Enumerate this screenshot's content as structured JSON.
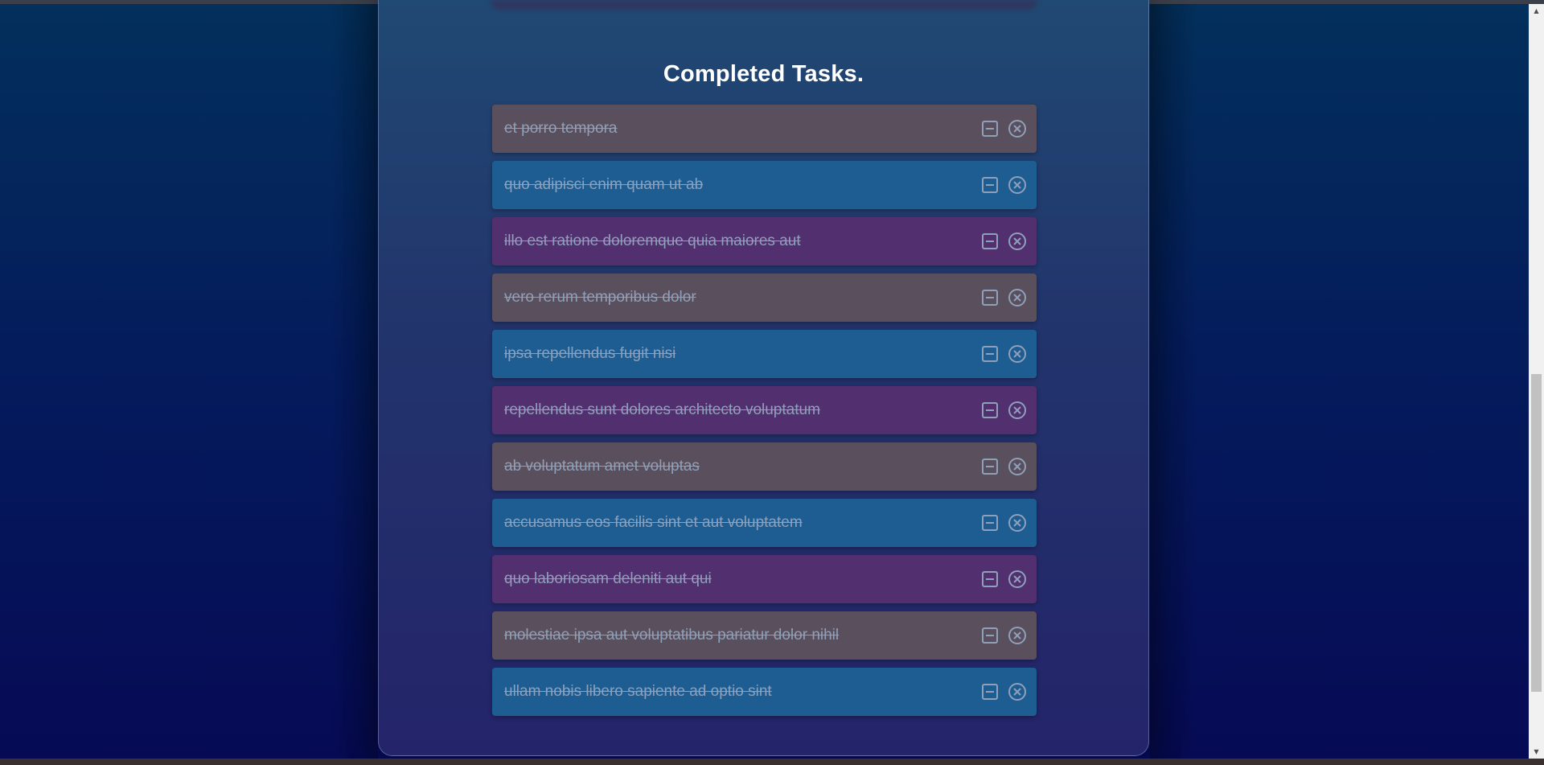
{
  "section": {
    "title": "Completed Tasks."
  },
  "tasks": [
    {
      "text": "et porro tempora",
      "color": "#5a4f5c"
    },
    {
      "text": "quo adipisci enim quam ut ab",
      "color": "#1e5d92"
    },
    {
      "text": "illo est ratione doloremque quia maiores aut",
      "color": "#522f6e"
    },
    {
      "text": "vero rerum temporibus dolor",
      "color": "#5a4f5c"
    },
    {
      "text": "ipsa repellendus fugit nisi",
      "color": "#1e5d92"
    },
    {
      "text": "repellendus sunt dolores architecto voluptatum",
      "color": "#522f6e"
    },
    {
      "text": "ab voluptatum amet voluptas",
      "color": "#5a4f5c"
    },
    {
      "text": "accusamus eos facilis sint et aut voluptatem",
      "color": "#1e5d92"
    },
    {
      "text": "quo laboriosam deleniti aut qui",
      "color": "#522f6e"
    },
    {
      "text": "molestiae ipsa aut voluptatibus pariatur dolor nihil",
      "color": "#5a4f5c"
    },
    {
      "text": "ullam nobis libero sapiente ad optio sint",
      "color": "#1e5d92"
    }
  ],
  "icons": {
    "undo": "minus-square-icon",
    "delete": "x-circle-icon"
  },
  "colors": {
    "task_text": "#8ea0ba",
    "title": "#ffffff"
  }
}
